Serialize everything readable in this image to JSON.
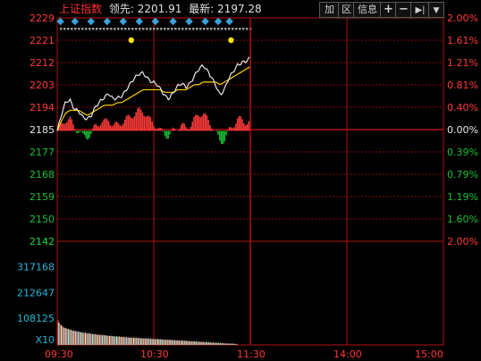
{
  "header": {
    "index_name": "上证指数",
    "leader_label": "领先:",
    "leader_value": "2201.91",
    "latest_label": "最新:",
    "latest_value": "2197.28"
  },
  "toolbar": {
    "add_label": "加",
    "range_label": "区",
    "info_label": "信息",
    "zoom_in_icon": "plus-icon",
    "zoom_out_icon": "minus-icon",
    "jump_end_icon": "jump-to-end-icon",
    "menu_icon": "dropdown-arrow-icon"
  },
  "colors": {
    "background": "#000000",
    "frame": "#b01010",
    "up": "#ff3a3a",
    "down": "#19c037",
    "neutral": "#e8e8e8",
    "volume_axis": "#25b6d8",
    "header_red": "#ff3030",
    "header_yellow": "#ffd200",
    "marker_blue": "#3aa2d8",
    "marker_yellow": "#ffe400"
  },
  "chart_data": [
    {
      "type": "line",
      "title": "上证指数",
      "x": [
        "09:30",
        "10:30",
        "11:30",
        "14:00",
        "15:00"
      ],
      "ylim": [
        2142,
        2229
      ],
      "prev_close": 2185,
      "price_ticks": [
        "2229",
        "2221",
        "2212",
        "2203",
        "2194",
        "2185",
        "2177",
        "2168",
        "2159",
        "2150",
        "2142"
      ],
      "pct_ticks": [
        "2.00%",
        "1.61%",
        "1.21%",
        "0.81%",
        "0.40%",
        "0.00%",
        "0.39%",
        "0.79%",
        "1.19%",
        "1.60%",
        "2.00%"
      ],
      "series": [
        {
          "name": "price",
          "values": [
            2185,
            2191,
            2196,
            2197,
            2194,
            2193,
            2190,
            2189,
            2191,
            2195,
            2197,
            2198,
            2199,
            2197,
            2198,
            2199,
            2201,
            2203,
            2205,
            2207,
            2208,
            2206,
            2204,
            2203,
            2201,
            2199,
            2198,
            2200,
            2202,
            2203,
            2202,
            2204,
            2207,
            2209,
            2210,
            2208,
            2206,
            2203,
            2199,
            2201,
            2205,
            2208,
            2211,
            2212,
            2212,
            2213
          ]
        },
        {
          "name": "average",
          "values": [
            2185,
            2189,
            2192,
            2193,
            2193,
            2193,
            2192,
            2191,
            2192,
            2193,
            2194,
            2195,
            2195,
            2195,
            2196,
            2196,
            2197,
            2198,
            2199,
            2200,
            2201,
            2201,
            2201,
            2201,
            2201,
            2200,
            2200,
            2200,
            2201,
            2201,
            2201,
            2202,
            2203,
            2203,
            2204,
            2204,
            2204,
            2204,
            2203,
            2204,
            2205,
            2206,
            2207,
            2208,
            2209,
            2210
          ]
        }
      ],
      "xlabel": "",
      "ylabel": ""
    },
    {
      "type": "bar",
      "title": "",
      "y_ticks": [
        "317168",
        "212647",
        "108125"
      ],
      "multiplier_label": "X10",
      "values": [
        100800,
        92000,
        87000,
        82000,
        80000,
        76000,
        74000,
        71000,
        69000,
        70000,
        67000,
        66000,
        65000,
        64000,
        62000,
        63000,
        61000,
        60000,
        58000,
        57000,
        59000,
        56000,
        55000,
        57000,
        54000,
        53000,
        55000,
        52000,
        51000,
        53000,
        50000,
        49000,
        51000,
        48000,
        50000,
        47000,
        48000,
        46000,
        49000,
        45000,
        47000,
        44000,
        46000,
        43000,
        45000,
        42000,
        44000,
        42000,
        43000,
        41000,
        42000,
        40000,
        41000,
        40000,
        42000,
        39000,
        41000,
        38000,
        40000,
        38000,
        39000,
        37000,
        38000,
        37000,
        36000,
        38000,
        35000,
        37000,
        36000,
        35000,
        34000,
        36000,
        33000,
        35000,
        34000,
        33000,
        35000,
        32000,
        34000,
        33000,
        32000,
        31000,
        33000,
        30000,
        32000,
        31000,
        30000,
        32000,
        29000,
        31000,
        30000,
        29000,
        31000,
        28000,
        30000,
        29000,
        28000,
        30000,
        27000,
        29000,
        28000,
        27000,
        29000,
        26000,
        28000,
        27000,
        26000,
        28000,
        25000,
        27000,
        26000,
        25000,
        27000,
        24000,
        26000,
        25000,
        24000,
        26000,
        23000,
        25000,
        24000,
        23000,
        25000,
        22000,
        24000,
        23000,
        22000,
        24000,
        21000,
        23000,
        22000,
        21000,
        23000,
        20000,
        22000,
        21000,
        20000,
        22000,
        19000,
        21000,
        20000,
        19000,
        21000,
        18000,
        20000,
        19000,
        18000,
        20000,
        17000,
        19000,
        18000,
        17000,
        19000,
        16000,
        18000,
        17000,
        16000,
        18000,
        15000,
        17000,
        16000,
        15000,
        17000,
        14000,
        16000,
        15000,
        14000,
        16000,
        13000,
        15000,
        14000,
        13000,
        15000,
        12000,
        14000,
        13000,
        12000,
        14000,
        11000,
        13000,
        12000,
        11000,
        13000,
        10000,
        12000,
        11000,
        10000,
        12000,
        9000,
        11000,
        10000,
        9000,
        11000,
        8000,
        10000,
        9000,
        8000,
        10000,
        7000,
        9000,
        8000,
        7000,
        9000,
        6000,
        8000,
        7000,
        6000,
        8000,
        5000,
        7000,
        6000,
        5000,
        7000,
        4000,
        6000,
        5000,
        4000,
        6000,
        3000,
        5000,
        4000,
        3000,
        5000,
        2000
      ]
    }
  ]
}
